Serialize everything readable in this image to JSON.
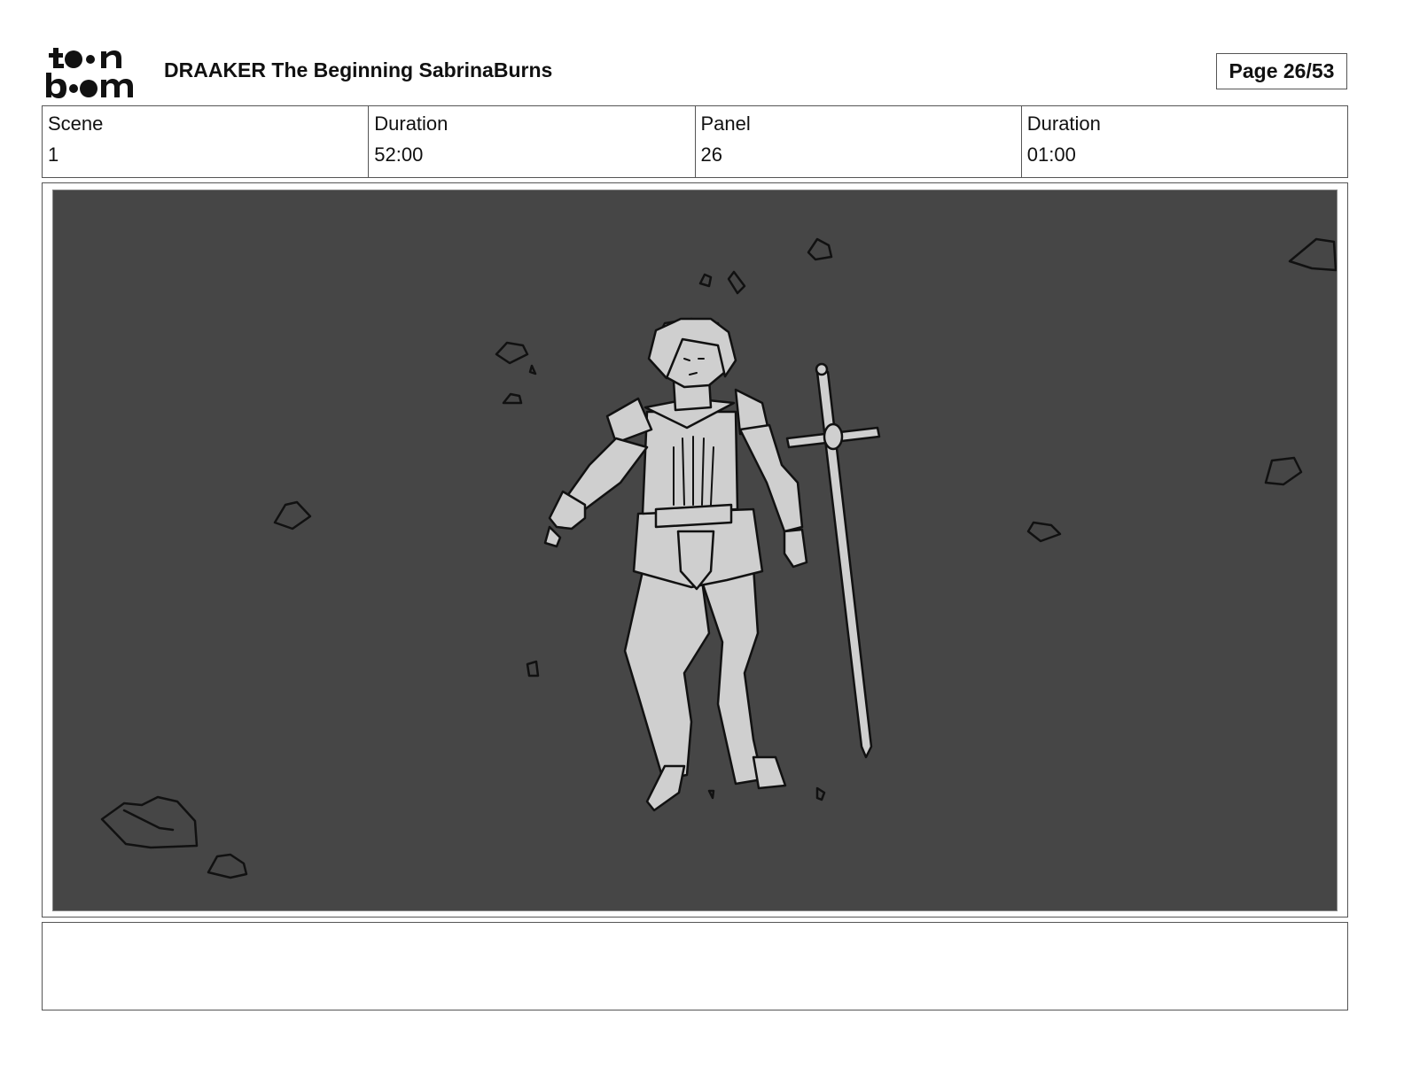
{
  "header": {
    "logo_text": "toon boom",
    "title": "DRAAKER The Beginning SabrinaBurns",
    "page_label": "Page 26/53"
  },
  "info": {
    "scene_label": "Scene",
    "scene_value": "1",
    "duration_label": "Duration",
    "duration_value": "52:00",
    "panel_label": "Panel",
    "panel_value": "26",
    "panel_duration_label": "Duration",
    "panel_duration_value": "01:00"
  },
  "panel": {
    "image_subject": "knight-with-sword-sketch",
    "background_color": "#464646",
    "figure_color": "#cfcfcf"
  },
  "notes": {
    "text": ""
  }
}
